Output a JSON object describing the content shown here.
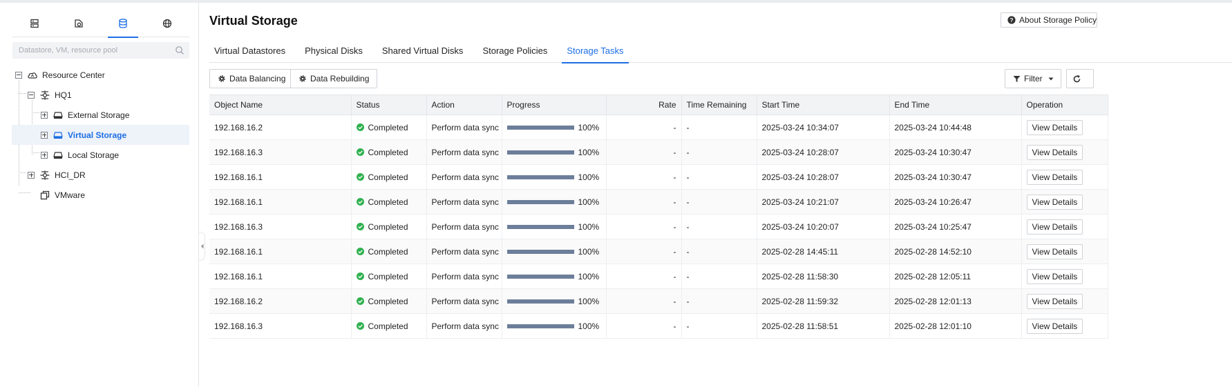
{
  "sidebar": {
    "tab_icons": [
      "host-icon",
      "vm-icon",
      "storage-icon",
      "network-icon"
    ],
    "active_tab": 2,
    "search_placeholder": "Datastore, VM, resource pool",
    "tree": {
      "root": "Resource Center",
      "hq1": "HQ1",
      "external": "External Storage",
      "virtual": "Virtual Storage",
      "local": "Local Storage",
      "hci_dr": "HCI_DR",
      "vmware": "VMware"
    }
  },
  "header": {
    "title": "Virtual Storage",
    "about_label": "About Storage Policy"
  },
  "tabs": [
    {
      "label": "Virtual Datastores"
    },
    {
      "label": "Physical Disks"
    },
    {
      "label": "Shared Virtual Disks"
    },
    {
      "label": "Storage Policies"
    },
    {
      "label": "Storage Tasks"
    }
  ],
  "active_tab": 4,
  "toolbar": {
    "data_balancing": "Data Balancing",
    "data_rebuilding": "Data Rebuilding",
    "filter": "Filter"
  },
  "table": {
    "columns": [
      "Object Name",
      "Status",
      "Action",
      "Progress",
      "Rate",
      "Time Remaining",
      "Start Time",
      "End Time",
      "Operation"
    ],
    "rows": [
      {
        "object": "192.168.16.2",
        "status": "Completed",
        "action": "Perform data sync",
        "progress": 100,
        "progress_text": "100%",
        "rate": "-",
        "remaining": "-",
        "start": "2025-03-24 10:34:07",
        "end": "2025-03-24 10:44:48",
        "op": "View Details"
      },
      {
        "object": "192.168.16.3",
        "status": "Completed",
        "action": "Perform data sync",
        "progress": 100,
        "progress_text": "100%",
        "rate": "-",
        "remaining": "-",
        "start": "2025-03-24 10:28:07",
        "end": "2025-03-24 10:30:47",
        "op": "View Details"
      },
      {
        "object": "192.168.16.1",
        "status": "Completed",
        "action": "Perform data sync",
        "progress": 100,
        "progress_text": "100%",
        "rate": "-",
        "remaining": "-",
        "start": "2025-03-24 10:28:07",
        "end": "2025-03-24 10:30:47",
        "op": "View Details"
      },
      {
        "object": "192.168.16.1",
        "status": "Completed",
        "action": "Perform data sync",
        "progress": 100,
        "progress_text": "100%",
        "rate": "-",
        "remaining": "-",
        "start": "2025-03-24 10:21:07",
        "end": "2025-03-24 10:26:47",
        "op": "View Details"
      },
      {
        "object": "192.168.16.3",
        "status": "Completed",
        "action": "Perform data sync",
        "progress": 100,
        "progress_text": "100%",
        "rate": "-",
        "remaining": "-",
        "start": "2025-03-24 10:20:07",
        "end": "2025-03-24 10:25:47",
        "op": "View Details"
      },
      {
        "object": "192.168.16.1",
        "status": "Completed",
        "action": "Perform data sync",
        "progress": 100,
        "progress_text": "100%",
        "rate": "-",
        "remaining": "-",
        "start": "2025-02-28 14:45:11",
        "end": "2025-02-28 14:52:10",
        "op": "View Details"
      },
      {
        "object": "192.168.16.1",
        "status": "Completed",
        "action": "Perform data sync",
        "progress": 100,
        "progress_text": "100%",
        "rate": "-",
        "remaining": "-",
        "start": "2025-02-28 11:58:30",
        "end": "2025-02-28 12:05:11",
        "op": "View Details"
      },
      {
        "object": "192.168.16.2",
        "status": "Completed",
        "action": "Perform data sync",
        "progress": 100,
        "progress_text": "100%",
        "rate": "-",
        "remaining": "-",
        "start": "2025-02-28 11:59:32",
        "end": "2025-02-28 12:01:13",
        "op": "View Details"
      },
      {
        "object": "192.168.16.3",
        "status": "Completed",
        "action": "Perform data sync",
        "progress": 100,
        "progress_text": "100%",
        "rate": "-",
        "remaining": "-",
        "start": "2025-02-28 11:58:51",
        "end": "2025-02-28 12:01:10",
        "op": "View Details"
      }
    ]
  },
  "colors": {
    "accent": "#1c6ee4",
    "success": "#2fb14f",
    "progress_fill": "#6c7e99"
  }
}
